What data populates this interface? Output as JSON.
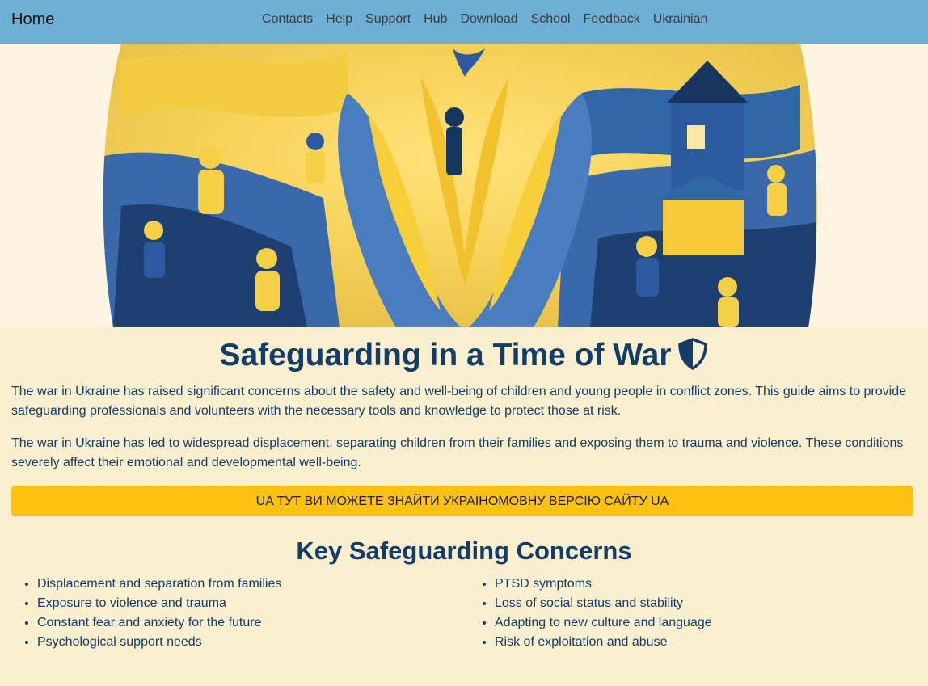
{
  "nav": {
    "brand": "Home",
    "links": [
      "Contacts",
      "Help",
      "Support",
      "Hub",
      "Download",
      "School",
      "Feedback",
      "Ukrainian"
    ]
  },
  "hero": {
    "icon": "illustration-ukraine-hands"
  },
  "main": {
    "title": "Safeguarding in a Time of War",
    "title_icon": "shield-half-icon",
    "paragraphs": [
      "The war in Ukraine has raised significant concerns about the safety and well-being of children and young people in conflict zones. This guide aims to provide safeguarding professionals and volunteers with the necessary tools and knowledge to protect those at risk.",
      "The war in Ukraine has led to widespread displacement, separating children from their families and exposing them to trauma and violence. These conditions severely affect their emotional and developmental well-being."
    ],
    "ua_button": "UA ТУТ ВИ МОЖЕТЕ ЗНАЙТИ УКРАЇНОМОВНУ ВЕРСІЮ САЙТУ UA",
    "concerns_title": "Key Safeguarding Concerns",
    "concerns_left": [
      "Displacement and separation from families",
      "Exposure to violence and trauma",
      "Constant fear and anxiety for the future",
      "Psychological support needs"
    ],
    "concerns_right": [
      "PTSD symptoms",
      "Loss of social status and stability",
      "Adapting to new culture and language",
      "Risk of exploitation and abuse"
    ]
  },
  "colors": {
    "navbar": "#70afd5",
    "background": "#faefcf",
    "text": "#123c69",
    "button": "#fdc210"
  }
}
